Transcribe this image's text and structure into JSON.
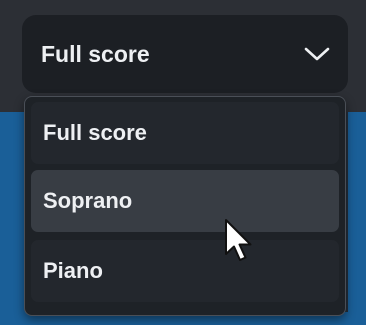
{
  "dropdown": {
    "selected": "Full score",
    "options": [
      {
        "label": "Full score"
      },
      {
        "label": "Soprano"
      },
      {
        "label": "Piano"
      }
    ],
    "highlighted": "Soprano"
  },
  "icons": {
    "toggle": "chevron-down-icon",
    "pointer": "mouse-cursor-icon"
  },
  "colors": {
    "background_blue": "#1a5f98",
    "control_bg": "#1c1f24",
    "hover_bg": "#383d44",
    "text": "#eef0f3"
  }
}
